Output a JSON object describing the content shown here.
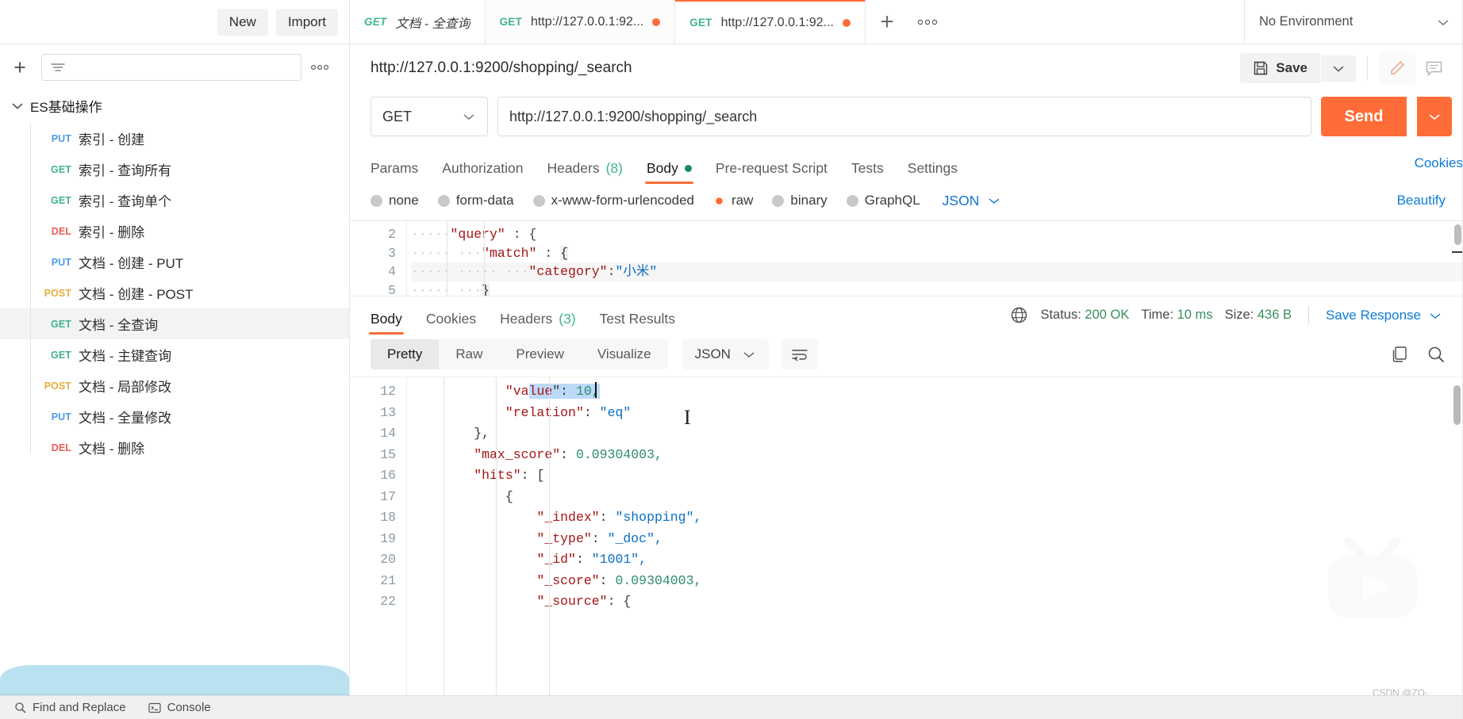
{
  "topbar": {
    "new_label": "New",
    "import_label": "Import",
    "tabs": [
      {
        "method": "GET",
        "title": "文档 - 全查询",
        "unsaved": false,
        "active": false,
        "preview": true
      },
      {
        "method": "GET",
        "title": "http://127.0.0.1:92...",
        "unsaved": true,
        "active": false,
        "preview": false
      },
      {
        "method": "GET",
        "title": "http://127.0.0.1:92...",
        "unsaved": true,
        "active": true,
        "preview": false
      }
    ],
    "add_tab_icon": "plus-icon",
    "tab_options_icon": "ellipsis-icon",
    "environment": "No Environment",
    "environment_caret_icon": "chevron-down-icon"
  },
  "sidebar": {
    "add_icon": "plus-icon",
    "filter_icon": "filter-icon",
    "search_placeholder": "",
    "more_icon": "ellipsis-icon",
    "collection": {
      "name": "ES基础操作",
      "expanded_icon": "chevron-down-icon"
    },
    "items": [
      {
        "method": "PUT",
        "name": "索引 - 创建",
        "selected": false
      },
      {
        "method": "GET",
        "name": "索引 - 查询所有",
        "selected": false
      },
      {
        "method": "GET",
        "name": "索引 - 查询单个",
        "selected": false
      },
      {
        "method": "DEL",
        "name": "索引 - 删除",
        "selected": false
      },
      {
        "method": "PUT",
        "name": "文档 - 创建 - PUT",
        "selected": false
      },
      {
        "method": "POST",
        "name": "文档 - 创建 - POST",
        "selected": false
      },
      {
        "method": "GET",
        "name": "文档 - 全查询",
        "selected": true
      },
      {
        "method": "GET",
        "name": "文档 - 主键查询",
        "selected": false
      },
      {
        "method": "POST",
        "name": "文档 - 局部修改",
        "selected": false
      },
      {
        "method": "PUT",
        "name": "文档 - 全量修改",
        "selected": false
      },
      {
        "method": "DEL",
        "name": "文档 - 删除",
        "selected": false
      }
    ]
  },
  "request": {
    "title": "http://127.0.0.1:9200/shopping/_search",
    "save_label": "Save",
    "save_icon": "floppy-disk-icon",
    "save_caret_icon": "chevron-down-icon",
    "edit_icon": "pencil-icon",
    "comment_icon": "comment-icon",
    "method": "GET",
    "method_caret_icon": "chevron-down-icon",
    "url": "http://127.0.0.1:9200/shopping/_search",
    "send_label": "Send",
    "send_caret_icon": "chevron-down-icon",
    "tabs": [
      {
        "label": "Params",
        "count": "",
        "active": false,
        "dot": false
      },
      {
        "label": "Authorization",
        "count": "",
        "active": false,
        "dot": false
      },
      {
        "label": "Headers",
        "count": "(8)",
        "active": false,
        "dot": false
      },
      {
        "label": "Body",
        "count": "",
        "active": true,
        "dot": true
      },
      {
        "label": "Pre-request Script",
        "count": "",
        "active": false,
        "dot": false
      },
      {
        "label": "Tests",
        "count": "",
        "active": false,
        "dot": false
      },
      {
        "label": "Settings",
        "count": "",
        "active": false,
        "dot": false
      }
    ],
    "cookies_label": "Cookies",
    "body_types": [
      {
        "label": "none",
        "selected": false
      },
      {
        "label": "form-data",
        "selected": false
      },
      {
        "label": "x-www-form-urlencoded",
        "selected": false
      },
      {
        "label": "raw",
        "selected": true
      },
      {
        "label": "binary",
        "selected": false
      },
      {
        "label": "GraphQL",
        "selected": false
      }
    ],
    "raw_format": "JSON",
    "raw_format_caret_icon": "chevron-down-icon",
    "beautify_label": "Beautify",
    "body_lines": [
      {
        "no": "2",
        "text": "    \"query\" : {"
      },
      {
        "no": "3",
        "text": "        \"match\" : {"
      },
      {
        "no": "4",
        "text": "            \"category\":\"小米\""
      },
      {
        "no": "5",
        "text": "        }"
      }
    ]
  },
  "response": {
    "tabs": [
      {
        "label": "Body",
        "count": "",
        "active": true
      },
      {
        "label": "Cookies",
        "count": "",
        "active": false
      },
      {
        "label": "Headers",
        "count": "(3)",
        "active": false
      },
      {
        "label": "Test Results",
        "count": "",
        "active": false
      }
    ],
    "globe_icon": "globe-icon",
    "status_label": "Status:",
    "status_value": "200 OK",
    "time_label": "Time:",
    "time_value": "10 ms",
    "size_label": "Size:",
    "size_value": "436 B",
    "save_response_label": "Save Response",
    "save_response_caret_icon": "chevron-down-icon",
    "views": [
      {
        "label": "Pretty",
        "active": true
      },
      {
        "label": "Raw",
        "active": false
      },
      {
        "label": "Preview",
        "active": false
      },
      {
        "label": "Visualize",
        "active": false
      }
    ],
    "format": "JSON",
    "format_caret_icon": "chevron-down-icon",
    "wrap_icon": "wrap-lines-icon",
    "copy_icon": "copy-icon",
    "search_icon": "search-icon",
    "lines": [
      {
        "no": "12",
        "indent": 12,
        "key": "\"value\"",
        "sep": ": ",
        "val": "10,",
        "type": "num",
        "selected": true
      },
      {
        "no": "13",
        "indent": 12,
        "key": "\"relation\"",
        "sep": ": ",
        "val": "\"eq\"",
        "type": "str",
        "selected": false
      },
      {
        "no": "14",
        "indent": 8,
        "key": "},",
        "sep": "",
        "val": "",
        "type": "punct",
        "selected": false
      },
      {
        "no": "15",
        "indent": 8,
        "key": "\"max_score\"",
        "sep": ": ",
        "val": "0.09304003,",
        "type": "num",
        "selected": false
      },
      {
        "no": "16",
        "indent": 8,
        "key": "\"hits\"",
        "sep": ": ",
        "val": "[",
        "type": "punct",
        "selected": false
      },
      {
        "no": "17",
        "indent": 12,
        "key": "{",
        "sep": "",
        "val": "",
        "type": "punct",
        "selected": false
      },
      {
        "no": "18",
        "indent": 16,
        "key": "\"_index\"",
        "sep": ": ",
        "val": "\"shopping\",",
        "type": "str",
        "selected": false
      },
      {
        "no": "19",
        "indent": 16,
        "key": "\"_type\"",
        "sep": ": ",
        "val": "\"_doc\",",
        "type": "str",
        "selected": false
      },
      {
        "no": "20",
        "indent": 16,
        "key": "\"_id\"",
        "sep": ": ",
        "val": "\"1001\",",
        "type": "str",
        "selected": false
      },
      {
        "no": "21",
        "indent": 16,
        "key": "\"_score\"",
        "sep": ": ",
        "val": "0.09304003,",
        "type": "num",
        "selected": false
      },
      {
        "no": "22",
        "indent": 16,
        "key": "\"_source\"",
        "sep": ": ",
        "val": "{",
        "type": "punct",
        "selected": false
      }
    ]
  },
  "bottombar": {
    "find_replace_label": "Find and Replace",
    "find_replace_icon": "search-icon",
    "console_label": "Console",
    "console_icon": "terminal-icon"
  },
  "watermark": {
    "credit": "CSDN @ZQ-"
  },
  "colors": {
    "accent": "#ff6c37",
    "link": "#0e7cd8",
    "get": "#3eb489",
    "put": "#4f9ce8",
    "post": "#e8ae3d",
    "del": "#ef5b5b",
    "success": "#3a8f5e"
  }
}
